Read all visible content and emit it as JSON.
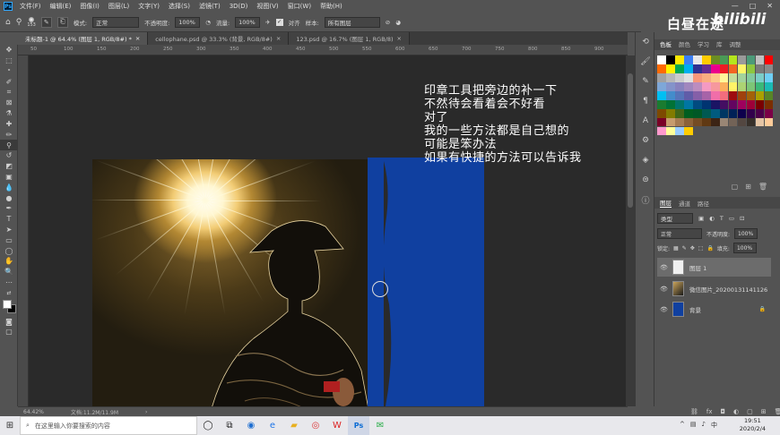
{
  "menu": [
    "文件(F)",
    "编辑(E)",
    "图像(I)",
    "图层(L)",
    "文字(Y)",
    "选择(S)",
    "滤镜(T)",
    "3D(D)",
    "视图(V)",
    "窗口(W)",
    "帮助(H)"
  ],
  "app_badge": "Ps",
  "window_controls": [
    "—",
    "□",
    "✕"
  ],
  "options": {
    "brush_size": "153",
    "mode_label": "模式:",
    "mode_value": "正常",
    "opacity_label": "不透明度:",
    "opacity_value": "100%",
    "flow_label": "流量:",
    "flow_value": "100%",
    "align_label": "对齐",
    "sample_label": "样本:",
    "sample_value": "所有图层"
  },
  "tabs": [
    {
      "label": "未标题-1 @ 64.4% (图层 1, RGB/8#) *",
      "close": "×",
      "active": true
    },
    {
      "label": "cellophane.psd @ 33.3% (背景, RGB/8#)",
      "close": "×",
      "active": false
    },
    {
      "label": "123.psd @ 16.7% (图层 1, RGB/8)",
      "close": "×",
      "active": false
    }
  ],
  "ruler_marks": [
    "50",
    "100",
    "150",
    "200",
    "250",
    "300",
    "350",
    "400",
    "450",
    "500",
    "550",
    "600",
    "650",
    "700",
    "750",
    "800",
    "850",
    "900"
  ],
  "overlay_text": [
    "印章工具把旁边的补一下",
    "不然待会看着会不好看",
    "对了",
    "我的一些方法都是自己想的",
    "可能是笨办法",
    "如果有快捷的方法可以告诉我"
  ],
  "status": {
    "zoom": "64.42%",
    "doc": "文档:11.2M/11.9M"
  },
  "watermark": "白昼在途",
  "bili_logo": "bilibili",
  "swatch_tabs": [
    "色板",
    "颜色",
    "学习",
    "库",
    "调整"
  ],
  "swatch_colors": [
    "#ffffff",
    "#000000",
    "#ffea00",
    "#3b7ff5",
    "#e8e8e8",
    "#ffcc00",
    "#6b8e23",
    "#4a9a56",
    "#b5e61d",
    "#9a9a9a",
    "#4c9a78",
    "#c0c0c0",
    "#ff0000",
    "#ff6a00",
    "#fff200",
    "#00a651",
    "#00aeef",
    "#2e3192",
    "#662d91",
    "#ec008c",
    "#ed1c24",
    "#f26522",
    "#fff568",
    "#8dc63f",
    "#7a7a7a",
    "#898989",
    "#a1a1a1",
    "#b7b7b7",
    "#cccccc",
    "#e0e0e0",
    "#f7977a",
    "#f9ad81",
    "#fdc68a",
    "#fff79a",
    "#c4df9b",
    "#a2d39c",
    "#82ca9d",
    "#7bcdc8",
    "#6ecff6",
    "#7ea7d8",
    "#8493ca",
    "#8882be",
    "#a187be",
    "#bc8dbf",
    "#f49ac2",
    "#f6989d",
    "#fbaf5d",
    "#fff467",
    "#acd373",
    "#7cc576",
    "#3bb878",
    "#1abbb4",
    "#00bff3",
    "#438ccb",
    "#5574b9",
    "#605ca8",
    "#855fa8",
    "#a763a8",
    "#f06ea9",
    "#f26d7d",
    "#9e0b0f",
    "#a0410d",
    "#a36209",
    "#aba000",
    "#598527",
    "#1a7b30",
    "#007236",
    "#00746b",
    "#0076a3",
    "#004b80",
    "#003471",
    "#1b1464",
    "#440e62",
    "#630460",
    "#9e005d",
    "#9e0039",
    "#790000",
    "#7b2e00",
    "#7d4900",
    "#827b00",
    "#406618",
    "#005e20",
    "#005826",
    "#005952",
    "#005b7f",
    "#003663",
    "#002157",
    "#0d004c",
    "#32004b",
    "#4b0049",
    "#7b0046",
    "#7a0026",
    "#c69c6d",
    "#a67c52",
    "#8c6239",
    "#754c24",
    "#603913",
    "#3c2415",
    "#998675",
    "#736357",
    "#534741",
    "#37302a",
    "#e5c5a5",
    "#ffcc99",
    "#ff99cc",
    "#ffff99",
    "#99ccff",
    "#ffcc00"
  ],
  "layer_tabs": [
    "图层",
    "通道",
    "路径"
  ],
  "layer_filter": "类型",
  "blend": {
    "mode": "正常",
    "opacity_label": "不透明度:",
    "opacity": "100%"
  },
  "lock": {
    "label": "锁定:",
    "fill_label": "填充:",
    "fill": "100%"
  },
  "layers": [
    {
      "name": "图层 1",
      "thumb": "#f0f0f0",
      "selected": true
    },
    {
      "name": "微信图片_20200131141126",
      "thumb": "#3a2e1a",
      "selected": false
    },
    {
      "name": "背景",
      "thumb": "#1040a0",
      "selected": false,
      "lock": "🔒"
    }
  ],
  "taskbar": {
    "search_placeholder": "在这里输入你要搜索的内容",
    "time": "19:51",
    "date": "2020/2/4"
  },
  "colors": {
    "accent_blue": "#1040a0",
    "ps_blue": "#31a8ff"
  }
}
